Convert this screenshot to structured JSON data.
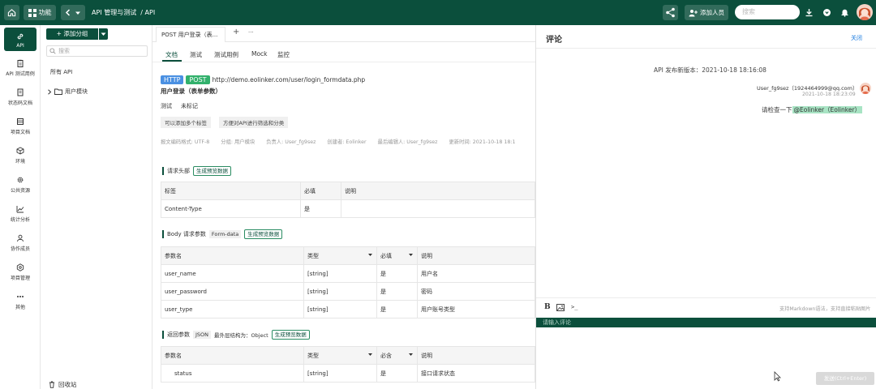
{
  "colors": {
    "brand": "#0b4f3c",
    "accent": "#2a8c62",
    "link": "#1e7de0",
    "http_tag": "#4a90e2",
    "post_tag": "#32b16c"
  },
  "topbar": {
    "home_icon": "home-icon",
    "func_label": "功能",
    "breadcrumb": "API 管理与测试  / API",
    "add_member_label": "添加人员",
    "search_placeholder": "搜索"
  },
  "leftnav": {
    "items": [
      {
        "label": "API",
        "icon": "link-icon"
      },
      {
        "label": "API 测试用例",
        "icon": "clipboard-icon"
      },
      {
        "label": "状态码文档",
        "icon": "doc-icon"
      },
      {
        "label": "项目文档",
        "icon": "book-icon"
      },
      {
        "label": "环境",
        "icon": "cube-icon"
      },
      {
        "label": "公共资源",
        "icon": "gear-icon"
      },
      {
        "label": "统计分析",
        "icon": "chart-icon"
      },
      {
        "label": "协作成员",
        "icon": "user-icon"
      },
      {
        "label": "项目管理",
        "icon": "settings-icon"
      },
      {
        "label": "其他",
        "icon": "more-icon"
      }
    ]
  },
  "tree": {
    "add_group": "+ 添加分组",
    "search_placeholder": "搜索",
    "all_api": "所有 API",
    "folder": "用户模块",
    "recycle": "回收站"
  },
  "tabs": {
    "active_tab": "POST 用户登录（表...",
    "plus": "+",
    "more": "···"
  },
  "subtabs": [
    "文档",
    "测试",
    "测试用例",
    "Mock",
    "监控"
  ],
  "api": {
    "protocol": "HTTP",
    "method": "POST",
    "url": "http://demo.eolinker.com/user/login_formdata.php",
    "name": "用户登录（表单参数）",
    "status_label": "测试",
    "tag_label": "未标记",
    "btn_add_tags": "可以添加多个标签",
    "btn_filter": "方便对API进行筛选和分类",
    "meta": {
      "encoding": "报文编码格式: UTF-8",
      "group": "分组: 用户模块",
      "owner": "负责人: User_fg9sez",
      "creator": "创建者: Eolinker",
      "last_editor": "最后编辑人: User_fg9sez",
      "updated": "更新时间: 2021-10-18 18:1"
    }
  },
  "headers_section": {
    "title": "请求头部",
    "gen_btn": "生成预览数据",
    "columns": [
      "标签",
      "必填",
      "说明"
    ],
    "rows": [
      [
        "Content-Type",
        "是",
        ""
      ]
    ]
  },
  "body_section": {
    "title": "Body 请求参数",
    "type_tag": "Form-data",
    "gen_btn": "生成预览数据",
    "columns": [
      "参数名",
      "类型",
      "必填",
      "说明"
    ],
    "rows": [
      [
        "user_name",
        "[string]",
        "是",
        "用户名"
      ],
      [
        "user_password",
        "[string]",
        "是",
        "密码"
      ],
      [
        "user_type",
        "[string]",
        "是",
        "用户账号类型"
      ]
    ]
  },
  "return_section": {
    "title": "返回参数",
    "type_tag": "JSON",
    "outer_structure": "最外层结构为：Object",
    "gen_btn": "生成预览数据",
    "columns": [
      "参数名",
      "类型",
      "必含",
      "说明"
    ],
    "rows": [
      [
        "status",
        "[string]",
        "是",
        "接口请求状态"
      ]
    ]
  },
  "comment_panel": {
    "title": "评论",
    "close_label": "关闭",
    "release_note": "API 发布新版本：2021-10-18 18:16:08",
    "comment_user": "User_fg9sez（1924464999@qq.com）",
    "comment_time": "2021-10-18 18:23:09",
    "comment_text": "请检查一下",
    "mention": "@Eolinker（Eolinker）",
    "editor_hint": "支持Markdown语法，支持直接粘贴图片",
    "input_placeholder": "请输入评论",
    "send_label": "发送(Ctrl+Enter)"
  }
}
